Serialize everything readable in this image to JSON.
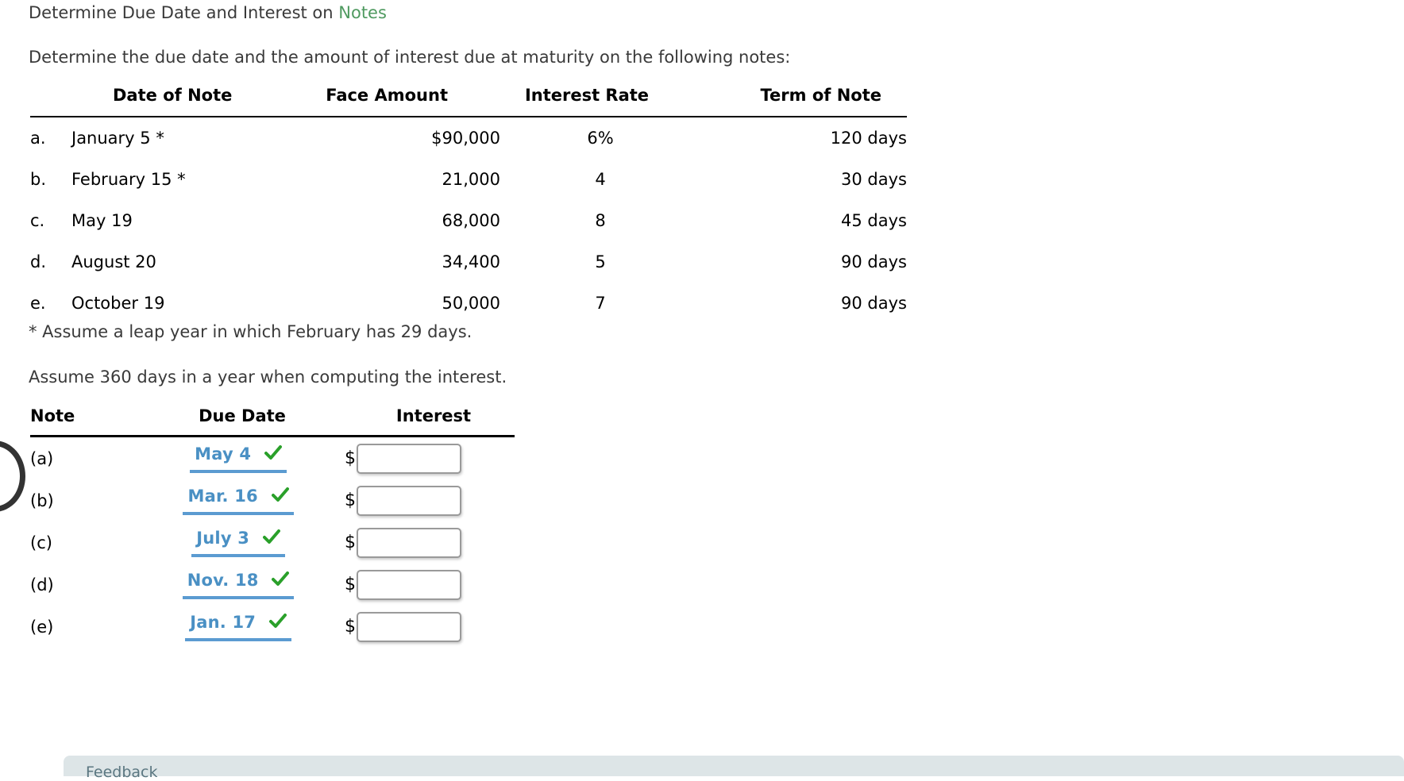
{
  "title": {
    "prefix": "Determine Due Date and Interest on ",
    "link_word": "Notes",
    "link_color": "#4f9a60"
  },
  "intro": "Determine the due date and the amount of interest due at maturity on the following notes:",
  "notes_table": {
    "headers": [
      "",
      "Date of Note",
      "Face Amount",
      "Interest Rate",
      "Term of Note"
    ],
    "rows": [
      {
        "key": "a.",
        "date_of_note": "January 5 *",
        "face_amount": "$90,000",
        "interest_rate": "6%",
        "term_of_note": "120 days"
      },
      {
        "key": "b.",
        "date_of_note": "February 15 *",
        "face_amount": "21,000",
        "interest_rate": "4",
        "term_of_note": "30 days"
      },
      {
        "key": "c.",
        "date_of_note": "May 19",
        "face_amount": "68,000",
        "interest_rate": "8",
        "term_of_note": "45 days"
      },
      {
        "key": "d.",
        "date_of_note": "August 20",
        "face_amount": "34,400",
        "interest_rate": "5",
        "term_of_note": "90 days"
      },
      {
        "key": "e.",
        "date_of_note": "October 19",
        "face_amount": "50,000",
        "interest_rate": "7",
        "term_of_note": "90 days"
      }
    ]
  },
  "footnote": "* Assume a leap year in which February has 29 days.",
  "assume_note": "Assume 360 days in a year when computing the interest.",
  "answer_table": {
    "headers": [
      "Note",
      "Due Date",
      "Interest"
    ],
    "dollar_symbol": "$",
    "due_date_color": "#4a90c4",
    "check_color": "#2aa02a",
    "rows": [
      {
        "note": "(a)",
        "due_date": "May 4",
        "check": "correct-check-icon",
        "interest_value": "",
        "interest_placeholder": ""
      },
      {
        "note": "(b)",
        "due_date": "Mar. 16",
        "check": "correct-check-icon",
        "interest_value": "",
        "interest_placeholder": ""
      },
      {
        "note": "(c)",
        "due_date": "July 3",
        "check": "correct-check-icon",
        "interest_value": "",
        "interest_placeholder": ""
      },
      {
        "note": "(d)",
        "due_date": "Nov. 18",
        "check": "correct-check-icon",
        "interest_value": "",
        "interest_placeholder": ""
      },
      {
        "note": "(e)",
        "due_date": "Jan. 17",
        "check": "correct-check-icon",
        "interest_value": "",
        "interest_placeholder": ""
      }
    ]
  },
  "feedback": {
    "label": "Feedback",
    "background": "#dde5e7",
    "text_color": "#5b7781"
  }
}
